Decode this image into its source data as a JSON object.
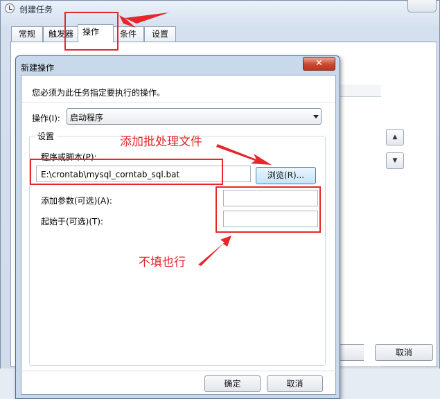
{
  "parent_window": {
    "title": "创建任务",
    "tabs": [
      {
        "label": "常规"
      },
      {
        "label": "触发器"
      },
      {
        "label": "操作"
      },
      {
        "label": "条件"
      },
      {
        "label": "设置"
      }
    ],
    "cancel_label": "取消"
  },
  "dialog": {
    "title": "新建操作",
    "close_glyph": "✕",
    "instruction": "您必须为此任务指定要执行的操作。",
    "action_label": "操作(I):",
    "action_value": "启动程序",
    "settings_label": "设置",
    "program_label": "程序或脚本(P):",
    "program_value": "E:\\crontab\\mysql_corntab_sql.bat",
    "browse_label": "浏览(R)...",
    "args_label": "添加参数(可选)(A):",
    "args_value": "",
    "start_in_label": "起始于(可选)(T):",
    "start_in_value": "",
    "ok_label": "确定",
    "cancel_label": "取消"
  },
  "annotations": {
    "add_batch_file": "添加批处理文件",
    "optional_note": "不填也行",
    "color": "#e5262a"
  },
  "icons": [
    "clock-icon",
    "close-icon",
    "dropdown-arrow-icon",
    "move-up-icon",
    "move-down-icon",
    "annotation-arrow-icon"
  ]
}
